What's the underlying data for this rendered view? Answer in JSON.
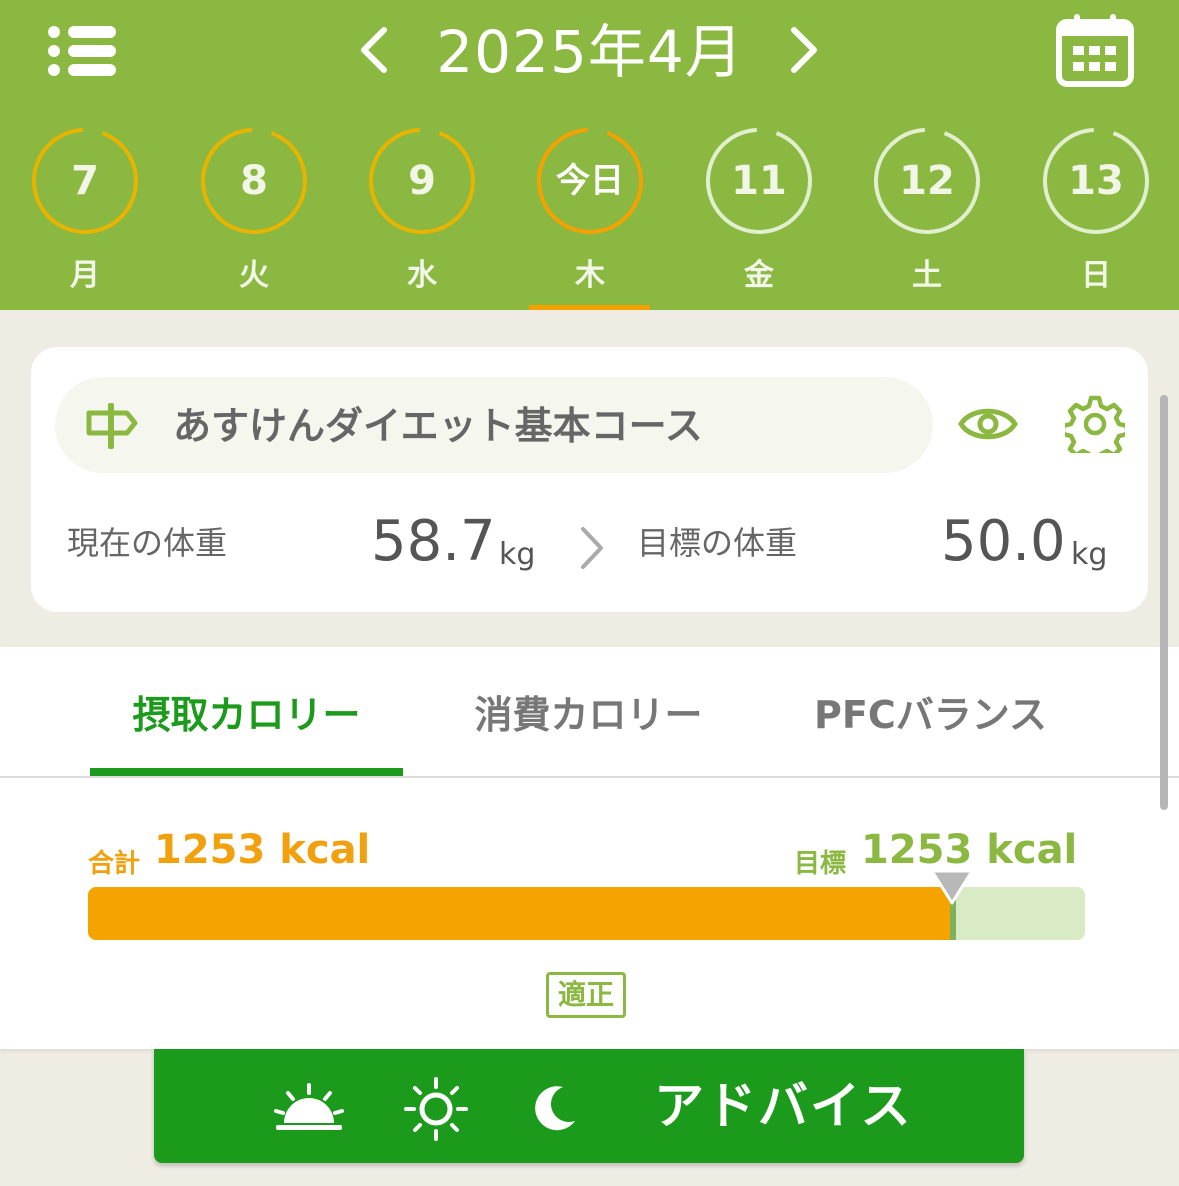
{
  "header": {
    "month_title": "2025年4月"
  },
  "week": [
    {
      "num": "7",
      "weekday": "月",
      "state": "past"
    },
    {
      "num": "8",
      "weekday": "火",
      "state": "past"
    },
    {
      "num": "9",
      "weekday": "水",
      "state": "past"
    },
    {
      "num": "今日",
      "weekday": "木",
      "state": "today"
    },
    {
      "num": "11",
      "weekday": "金",
      "state": "future"
    },
    {
      "num": "12",
      "weekday": "土",
      "state": "future"
    },
    {
      "num": "13",
      "weekday": "日",
      "state": "future"
    }
  ],
  "course": {
    "name": "あすけんダイエット基本コース",
    "current_label": "現在の体重",
    "current_value": "58.7",
    "current_unit": "kg",
    "target_label": "目標の体重",
    "target_value": "50.0",
    "target_unit": "kg"
  },
  "tabs": [
    {
      "label": "摂取カロリー",
      "active": true
    },
    {
      "label": "消費カロリー",
      "active": false
    },
    {
      "label": "PFCバランス",
      "active": false
    }
  ],
  "calorie": {
    "sum_label": "合計",
    "sum_value": "1253 kcal",
    "goal_label": "目標",
    "goal_value": "1253 kcal",
    "progress_fraction": 0.865,
    "status": "適正"
  },
  "bottom_bar": {
    "icons": [
      "sunrise-icon",
      "sun-icon",
      "moon-icon"
    ],
    "advice_label": "アドバイス"
  },
  "colors": {
    "header_green": "#8ab841",
    "accent_orange": "#f5a300",
    "tab_green": "#1c9a1c"
  }
}
